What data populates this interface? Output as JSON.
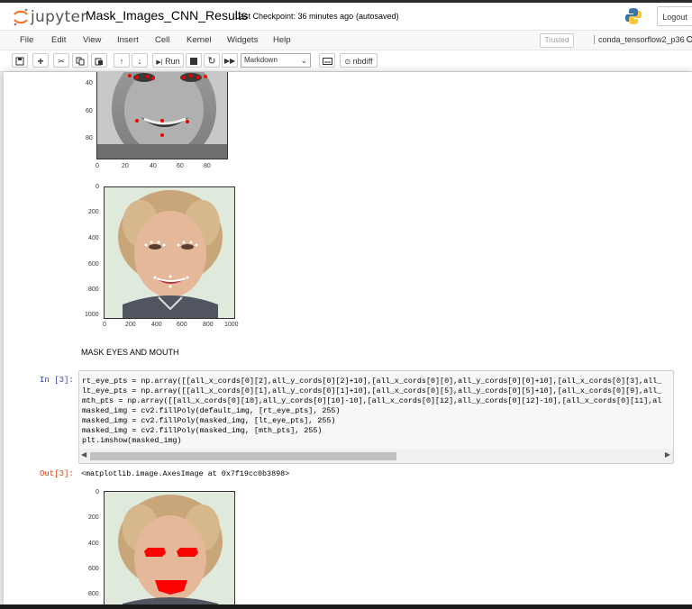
{
  "header": {
    "logo_text": "jupyter",
    "notebook_name": "Mask_Images_CNN_Results",
    "checkpoint": "Last Checkpoint: 36 minutes ago",
    "autosaved": "(autosaved)",
    "logout_label": "Logout"
  },
  "menubar": {
    "items": [
      "File",
      "Edit",
      "View",
      "Insert",
      "Cell",
      "Kernel",
      "Widgets",
      "Help"
    ],
    "trusted_label": "Trusted",
    "kernel_name": "conda_tensorflow2_p36"
  },
  "toolbar": {
    "run_label": "Run",
    "cell_type": "Markdown",
    "nbdiff_label": "nbdiff"
  },
  "plots": {
    "plot1_yticks": [
      "40",
      "60",
      "80"
    ],
    "plot1_xticks": [
      "0",
      "20",
      "40",
      "60",
      "80"
    ],
    "plot2_yticks": [
      "0",
      "200",
      "400",
      "600",
      "800",
      "1000"
    ],
    "plot2_xticks": [
      "0",
      "200",
      "400",
      "600",
      "800",
      "1000"
    ],
    "plot3_yticks": [
      "0",
      "200",
      "400",
      "600",
      "800"
    ]
  },
  "cells": {
    "markdown_text": "MASK EYES AND MOUTH",
    "in_prompt": "In [3]:",
    "code_lines": [
      "rt_eye_pts = np.array([[all_x_cords[0][2],all_y_cords[0][2]+10],[all_x_cords[0][0],all_y_cords[0][0]+10],[all_x_cords[0][3],all_",
      "lt_eye_pts = np.array([[all_x_cords[0][1],all_y_cords[0][1]+10],[all_x_cords[0][5],all_y_cords[0][5]+10],[all_x_cords[0][9],all_",
      "mth_pts = np.array([[all_x_cords[0][10],all_y_cords[0][10]-10],[all_x_cords[0][12],all_y_cords[0][12]-10],[all_x_cords[0][11],al",
      "masked_img = cv2.fillPoly(default_img, [rt_eye_pts], 255)",
      "masked_img = cv2.fillPoly(masked_img, [lt_eye_pts], 255)",
      "masked_img = cv2.fillPoly(masked_img, [mth_pts], 255)",
      "plt.imshow(masked_img)"
    ],
    "out_prompt": "Out[3]:",
    "out_text": "<matplotlib.image.AxesImage at 0x7f19cc0b3898>"
  }
}
